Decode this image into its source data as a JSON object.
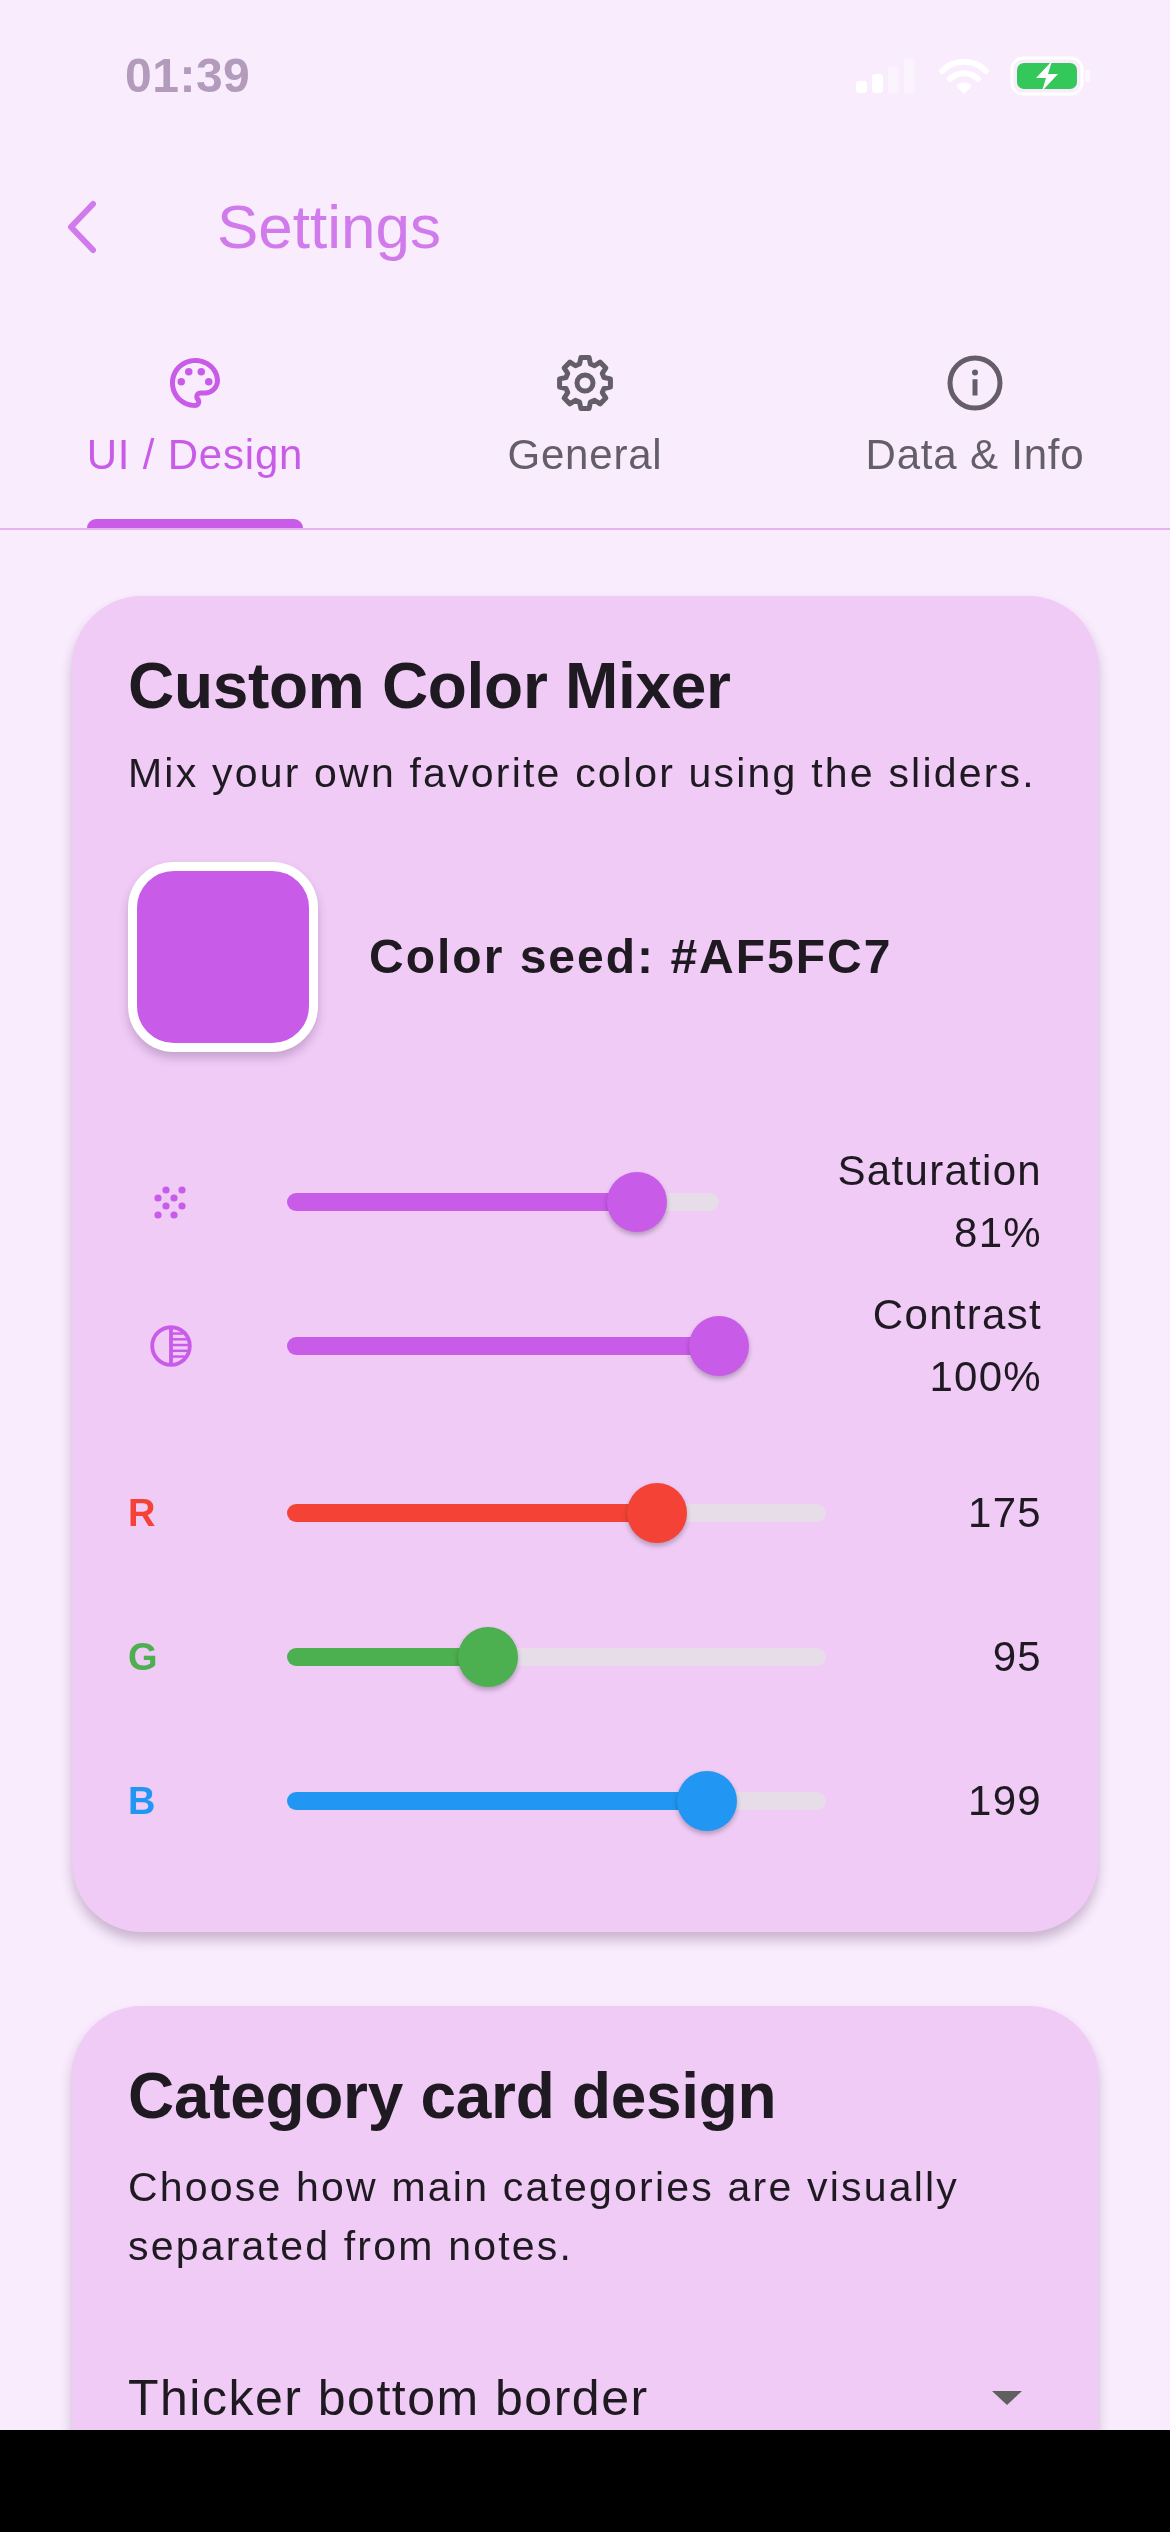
{
  "status_bar": {
    "time": "01:39"
  },
  "app_bar": {
    "title": "Settings"
  },
  "tabs": [
    {
      "label": "UI / Design",
      "selected": true
    },
    {
      "label": "General",
      "selected": false
    },
    {
      "label": "Data & Info",
      "selected": false
    }
  ],
  "color_mixer": {
    "title": "Custom Color Mixer",
    "description": "Mix your own favorite color using the sliders.",
    "swatch": {
      "color": "#c95be9"
    },
    "seed_label": "Color seed: #AF5FC7",
    "sliders": [
      {
        "kind": "saturation",
        "label": "Saturation",
        "reading": "81%",
        "level": 0.81
      },
      {
        "kind": "contrast",
        "label": "Contrast",
        "reading": "100%",
        "level": 1
      },
      {
        "kind": "channel",
        "label": "R",
        "reading": "175",
        "level": 0.686,
        "color": "#f44336"
      },
      {
        "kind": "channel",
        "label": "G",
        "reading": "95",
        "level": 0.373,
        "color": "#4caf50"
      },
      {
        "kind": "channel",
        "label": "B",
        "reading": "199",
        "level": 0.78,
        "color": "#2196f3"
      }
    ]
  },
  "category_card": {
    "title": "Category card design",
    "description": "Choose how main categories are visually separated from notes.",
    "dropdown": {
      "value": "Thicker bottom border"
    }
  }
}
